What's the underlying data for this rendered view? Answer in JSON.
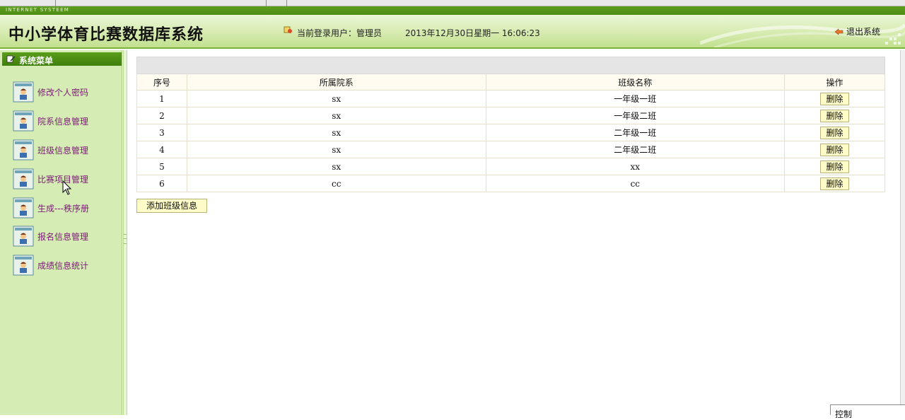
{
  "header": {
    "brand_tag": "INTERNET SYSTEEM",
    "title": "中小学体育比赛数据库系统",
    "user_label": "当前登录用户：管理员",
    "datetime": "2013年12月30日星期一  16:06:23",
    "exit_label": "退出系统"
  },
  "sidebar": {
    "heading": "系统菜单",
    "items": [
      {
        "label": "修改个人密码"
      },
      {
        "label": "院系信息管理"
      },
      {
        "label": "班级信息管理"
      },
      {
        "label": "比赛项目管理"
      },
      {
        "label": "生成---秩序册"
      },
      {
        "label": "报名信息管理"
      },
      {
        "label": "成绩信息统计"
      }
    ]
  },
  "table": {
    "columns": [
      "序号",
      "所属院系",
      "班级名称",
      "操作"
    ],
    "rows": [
      {
        "id": "1",
        "dept": "sx",
        "class_name": "一年级一班",
        "action": "删除"
      },
      {
        "id": "2",
        "dept": "sx",
        "class_name": "一年级二班",
        "action": "删除"
      },
      {
        "id": "3",
        "dept": "sx",
        "class_name": "二年级一班",
        "action": "删除"
      },
      {
        "id": "4",
        "dept": "sx",
        "class_name": "二年级二班",
        "action": "删除"
      },
      {
        "id": "5",
        "dept": "sx",
        "class_name": "xx",
        "action": "删除"
      },
      {
        "id": "6",
        "dept": "cc",
        "class_name": "cc",
        "action": "删除"
      }
    ]
  },
  "add_button_label": "添加班级信息",
  "corner_label": "控制",
  "colors": {
    "accent_green": "#4d8c14",
    "sidebar_bg": "#d5ecb4",
    "menu_text": "#7a1a74",
    "button_bg": "#fdfbc8"
  }
}
